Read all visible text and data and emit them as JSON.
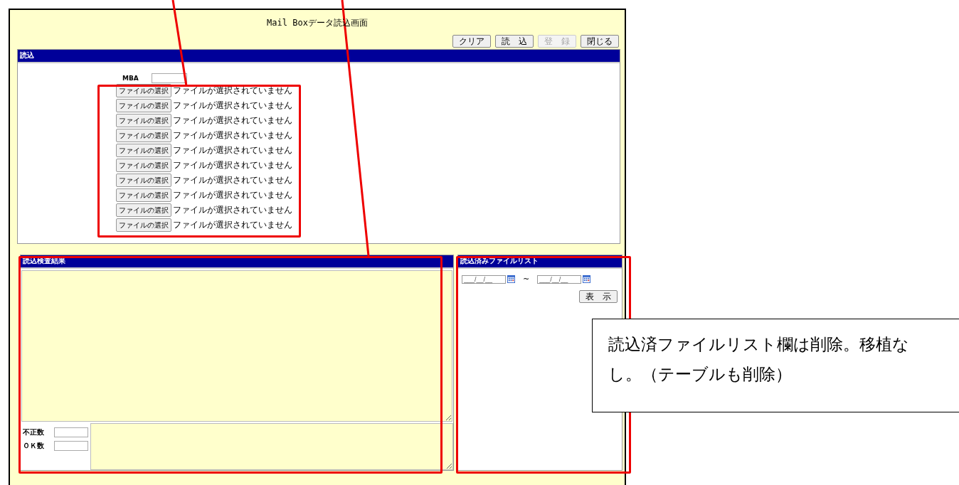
{
  "window": {
    "title": "Mail Boxデータ読込画面"
  },
  "toolbar": [
    {
      "label": "クリア",
      "disabled": false
    },
    {
      "label": "読　込",
      "disabled": false
    },
    {
      "label": "登　録",
      "disabled": true
    },
    {
      "label": "閉じる",
      "disabled": false
    }
  ],
  "read_section": {
    "title": "読込",
    "mba_label": "MBA",
    "file_rows": [
      {
        "button": "ファイルの選択",
        "status": "ファイルが選択されていません"
      },
      {
        "button": "ファイルの選択",
        "status": "ファイルが選択されていません"
      },
      {
        "button": "ファイルの選択",
        "status": "ファイルが選択されていません"
      },
      {
        "button": "ファイルの選択",
        "status": "ファイルが選択されていません"
      },
      {
        "button": "ファイルの選択",
        "status": "ファイルが選択されていません"
      },
      {
        "button": "ファイルの選択",
        "status": "ファイルが選択されていません"
      },
      {
        "button": "ファイルの選択",
        "status": "ファイルが選択されていません"
      },
      {
        "button": "ファイルの選択",
        "status": "ファイルが選択されていません"
      },
      {
        "button": "ファイルの選択",
        "status": "ファイルが選択されていません"
      },
      {
        "button": "ファイルの選択",
        "status": "ファイルが選択されていません"
      }
    ]
  },
  "result_section": {
    "title": "読込検査結果",
    "counts": [
      {
        "label": "不正数"
      },
      {
        "label": "ＯＫ数"
      }
    ]
  },
  "file_list_section": {
    "title": "読込済みファイルリスト",
    "date_from": "___/__/__",
    "separator": "~",
    "date_to": "___/__/__",
    "show_button": "表　示"
  },
  "annotation": {
    "callout": "読込済ファイルリスト欄は削除。移植なし。（テーブルも削除）"
  }
}
